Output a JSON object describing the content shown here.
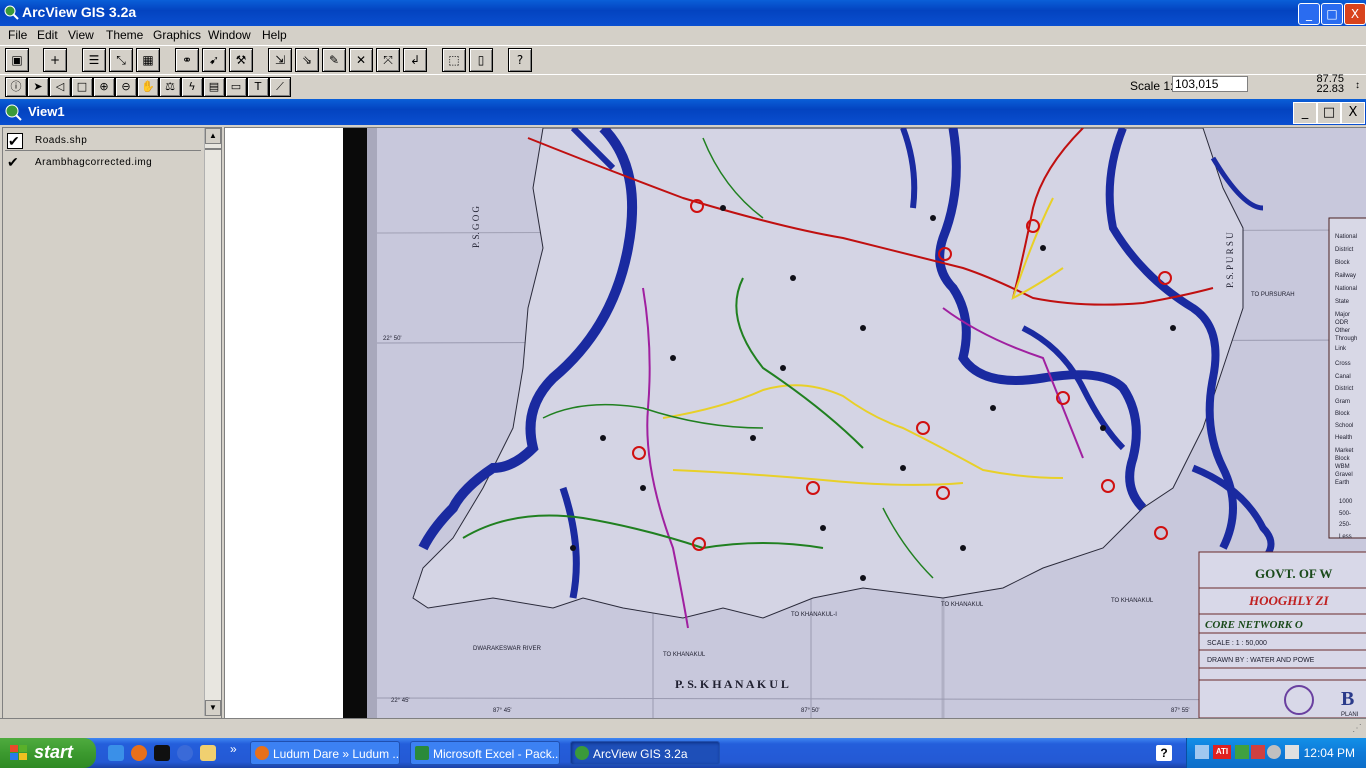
{
  "window": {
    "title": "ArcView GIS 3.2a",
    "minimize": "_",
    "maximize": "□",
    "close": "X"
  },
  "menu": [
    "File",
    "Edit",
    "View",
    "Theme",
    "Graphics",
    "Window",
    "Help"
  ],
  "toolbar": {
    "buttons": [
      "save-icon",
      "add-theme-icon",
      "theme-properties-icon",
      "edit-legend-icon",
      "open-table-icon",
      "find-icon",
      "locate-address-icon",
      "hotlink-icon",
      "zoom-full-extent-icon",
      "zoom-active-themes-icon",
      "zoom-selected-icon",
      "zoom-in-icon",
      "zoom-out-icon",
      "zoom-previous-icon",
      "select-by-theme-icon",
      "layout-icon",
      "help-icon"
    ]
  },
  "tools": [
    "identify-tool",
    "pointer-tool",
    "vertex-edit-tool",
    "select-feature-tool",
    "zoom-in-tool",
    "zoom-out-tool",
    "pan-tool",
    "measure-tool",
    "hotlink-tool",
    "area-of-interest-tool",
    "label-tool",
    "text-tool",
    "draw-tool"
  ],
  "scale": {
    "label": "Scale 1:",
    "value": "103,015"
  },
  "coords": {
    "x": "87.75",
    "y": "22.83"
  },
  "view": {
    "title": "View1",
    "minimize": "_",
    "maximize": "□",
    "close": "X"
  },
  "toc": [
    {
      "label": "Roads.shp",
      "checked": true
    },
    {
      "label": "Arambhagcorrected.img",
      "checked": true
    }
  ],
  "taskbar": {
    "start": "start",
    "tasks": [
      {
        "label": "Ludum Dare » Ludum ...",
        "active": false
      },
      {
        "label": "Microsoft Excel - Pack...",
        "active": false
      },
      {
        "label": "ArcView GIS 3.2a",
        "active": true
      }
    ],
    "overflow": "»",
    "clock": "12:04 PM"
  },
  "map_text": {
    "ps_khanakul": "P. S.    K H A N A K U L",
    "govt": "GOVT. OF W",
    "hooghly": "HOOGHLY ZI",
    "core": "CORE NETWORK O",
    "scale_text": "SCALE  :  1 : 50,000",
    "drawn": "DRAWN BY : WATER AND POWE",
    "to_khanakul": "TO KHANAKUL",
    "to_khanakul2": "TO KHANAKUL",
    "to_khanakul3": "TO KHANAKUL",
    "to_pursurah": "TO PURSURAH",
    "to_khanakul_i": "TO KHANAKUL-I",
    "dwarakeswar": "DWARAKESWAR RIVER",
    "lat1": "22° 50'",
    "lat2": "22° 45'",
    "lon1": "87° 45'",
    "lon2": "87° 50'",
    "lon3": "87° 55'",
    "ps_goghat": "P. S.   G O G",
    "ps_pursurah": "P. S.   P U R S U",
    "logo_b": "B",
    "planning": "PLANI",
    "legend_items": [
      "National",
      "District",
      "Block",
      "Railway",
      "National",
      "State",
      "Major",
      "ODR",
      "Other",
      "Through",
      "Link",
      "Cross",
      "Canal",
      "District",
      "Gram",
      "Block",
      "School",
      "Health",
      "Market",
      "Block",
      "WBM",
      "Gravel",
      "Earth"
    ],
    "legend_nums": [
      "1000",
      "500-",
      "250-",
      "Less"
    ]
  }
}
